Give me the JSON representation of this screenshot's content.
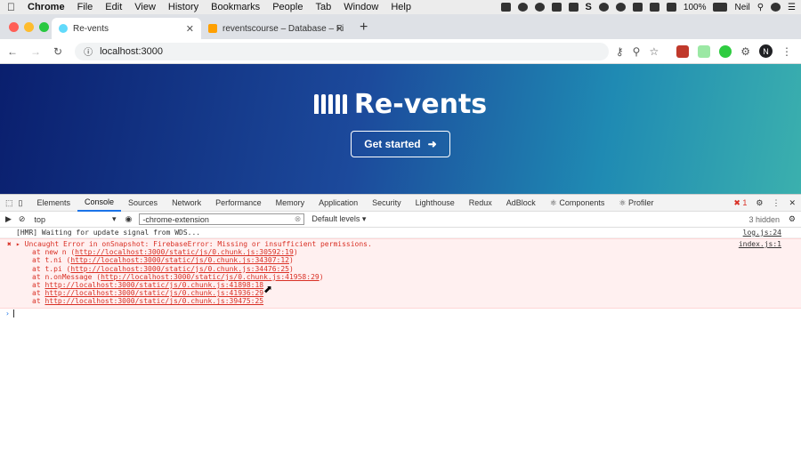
{
  "menubar": {
    "app": "Chrome",
    "items": [
      "File",
      "Edit",
      "View",
      "History",
      "Bookmarks",
      "People",
      "Tab",
      "Window",
      "Help"
    ],
    "battery": "100%",
    "user": "Neil"
  },
  "tabs": [
    {
      "title": "Re-vents",
      "active": true
    },
    {
      "title": "reventscourse – Database – Fi",
      "active": false
    }
  ],
  "address": {
    "url": "localhost:3000"
  },
  "hero": {
    "brand": "Re-vents",
    "cta": "Get started",
    "gradient_start": "#0a1f6e",
    "gradient_end": "#3bb0ae"
  },
  "devtools": {
    "tabs": [
      "Elements",
      "Console",
      "Sources",
      "Network",
      "Performance",
      "Memory",
      "Application",
      "Security",
      "Lighthouse",
      "Redux",
      "AdBlock",
      "Components",
      "Profiler"
    ],
    "active_tab": "Console",
    "error_count": "1",
    "context": "top",
    "filter": "-chrome-extension",
    "levels": "Default levels",
    "hidden": "3 hidden"
  },
  "console": {
    "hmr": {
      "text": "[HMR] Waiting for update signal from WDS...",
      "src": "log.js:24"
    },
    "error": {
      "message": "Uncaught Error in onSnapshot: FirebaseError: Missing or insufficient permissions.",
      "src": "index.js:1",
      "stack": [
        {
          "prefix": "at new n (",
          "link": "http://localhost:3000/static/js/0.chunk.js:30592:19",
          "suffix": ")"
        },
        {
          "prefix": "at t.ni (",
          "link": "http://localhost:3000/static/js/0.chunk.js:34307:12",
          "suffix": ")"
        },
        {
          "prefix": "at t.pi (",
          "link": "http://localhost:3000/static/js/0.chunk.js:34476:25",
          "suffix": ")"
        },
        {
          "prefix": "at n.onMessage (",
          "link": "http://localhost:3000/static/js/0.chunk.js:41958:29",
          "suffix": ")"
        },
        {
          "prefix": "at ",
          "link": "http://localhost:3000/static/js/0.chunk.js:41898:18",
          "suffix": ""
        },
        {
          "prefix": "at ",
          "link": "http://localhost:3000/static/js/0.chunk.js:41936:29",
          "suffix": ""
        },
        {
          "prefix": "at ",
          "link": "http://localhost:3000/static/js/0.chunk.js:39475:25",
          "suffix": ""
        }
      ]
    }
  }
}
